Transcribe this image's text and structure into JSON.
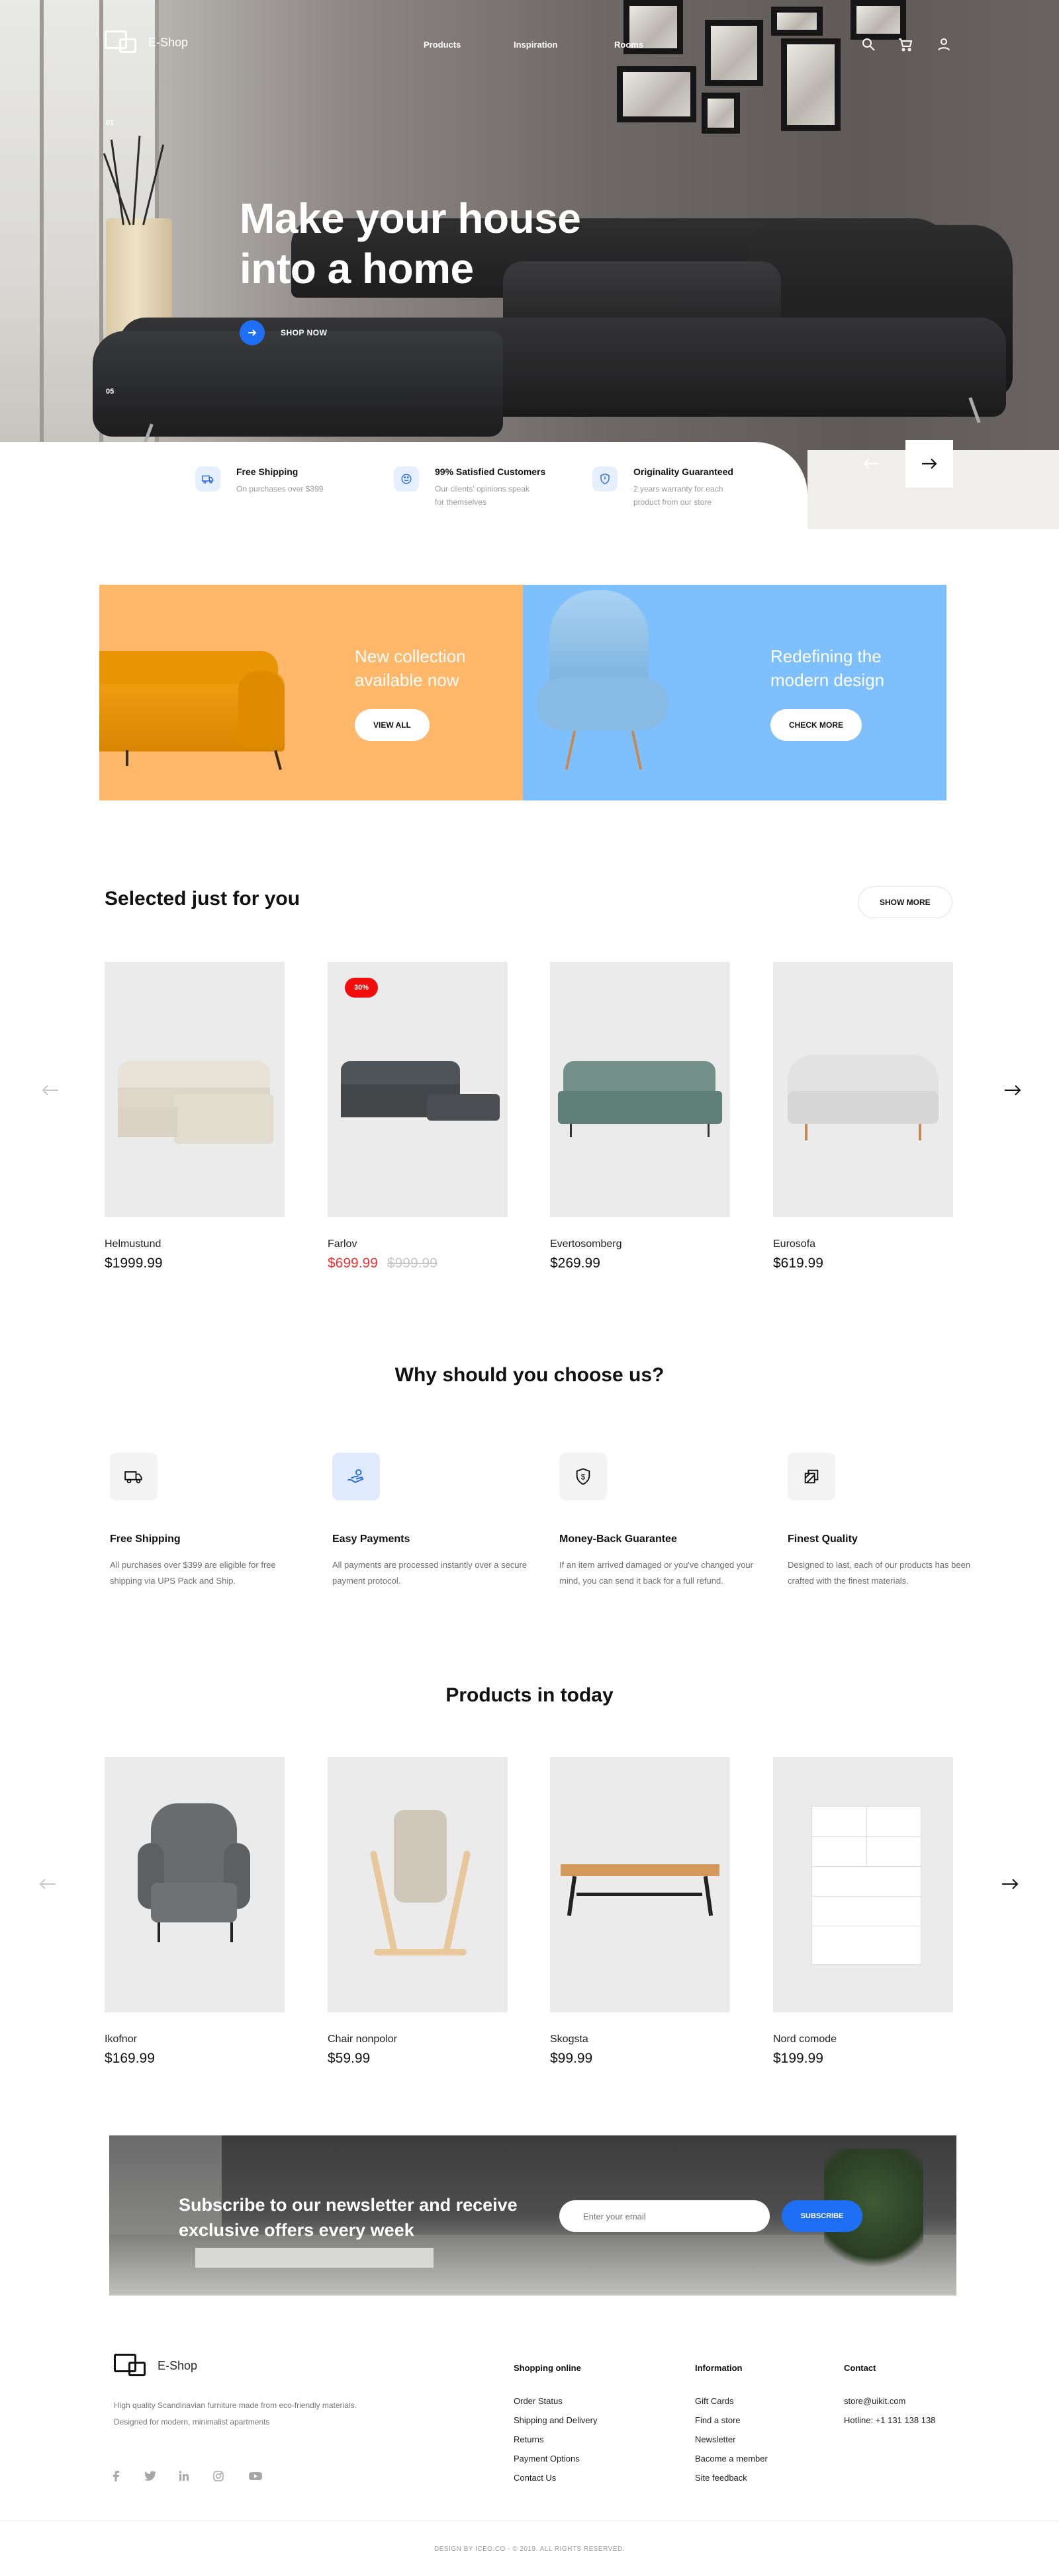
{
  "brand": {
    "name": "E-Shop"
  },
  "nav": {
    "links": [
      "Products",
      "Inspiration",
      "Rooms"
    ]
  },
  "hero": {
    "slide_index": "01",
    "slide_total": "05",
    "title": "Make your house into a home",
    "cta": "SHOP NOW",
    "features": [
      {
        "title": "Free Shipping",
        "text": "On purchases over $399",
        "icon": "truck-icon"
      },
      {
        "title": "99% Satisfied Customers",
        "text": "Our clients' opinions speak for themselves",
        "icon": "smile-icon"
      },
      {
        "title": "Originality Guaranteed",
        "text": "2 years warranty for each product from our store",
        "icon": "shield-icon"
      }
    ]
  },
  "promos": [
    {
      "title": "New collection available now",
      "button": "VIEW ALL",
      "color": "#ffb769"
    },
    {
      "title": "Redefining the modern design",
      "button": "CHECK MORE",
      "color": "#7ec0fd"
    }
  ],
  "selected": {
    "title": "Selected just for you",
    "show_more": "SHOW MORE",
    "products": [
      {
        "name": "Helmustund",
        "price": "$1999.99"
      },
      {
        "name": "Farlov",
        "price": "$699.99",
        "old_price": "$999.99",
        "badge": "30%"
      },
      {
        "name": "Evertosomberg",
        "price": "$269.99"
      },
      {
        "name": "Eurosofa",
        "price": "$619.99"
      }
    ]
  },
  "why": {
    "title": "Why should you choose us?",
    "items": [
      {
        "title": "Free Shipping",
        "text": "All purchases over $399 are eligible for free shipping via UPS Pack and Ship.",
        "icon": "truck-icon"
      },
      {
        "title": "Easy Payments",
        "text": "All payments are processed instantly over a secure payment protocol.",
        "icon": "hand-money-icon"
      },
      {
        "title": "Money-Back Guarantee",
        "text": "If an item arrived damaged or you've changed your mind, you can send it back for a full refund.",
        "icon": "dollar-shield-icon"
      },
      {
        "title": "Finest Quality",
        "text": "Designed to last, each of our products has been crafted with the finest materials.",
        "icon": "quality-icon"
      }
    ]
  },
  "today": {
    "title": "Products in today",
    "products": [
      {
        "name": "Ikofnor",
        "price": "$169.99"
      },
      {
        "name": "Chair nonpolor",
        "price": "$59.99"
      },
      {
        "name": "Skogsta",
        "price": "$99.99"
      },
      {
        "name": "Nord comode",
        "price": "$199.99"
      }
    ]
  },
  "newsletter": {
    "title": "Subscribe to our newsletter and receive exclusive offers every week",
    "placeholder": "Enter your email",
    "button": "SUBSCRIBE"
  },
  "footer": {
    "description": "High quality Scandinavian furniture made from eco-friendly materials. Designed for modern, minimalist apartments",
    "columns": [
      {
        "title": "Shopping online",
        "links": [
          "Order Status",
          "Shipping and Delivery",
          "Returns",
          "Payment Options",
          "Contact Us"
        ]
      },
      {
        "title": "Information",
        "links": [
          "Gift Cards",
          "Find a store",
          "Newsletter",
          "Bacome a member",
          "Site feedback"
        ]
      },
      {
        "title": "Contact",
        "links": [
          "store@uikit.com",
          "Hotline: +1 131 138 138"
        ]
      }
    ],
    "social": [
      "facebook-icon",
      "twitter-icon",
      "linkedin-icon",
      "instagram-icon",
      "youtube-icon"
    ],
    "copyright": "DESIGN BY ICEO.CO - © 2019. ALL RIGHTS RESERVED."
  },
  "colors": {
    "accent": "#1f6ff5",
    "sale": "#f20d0d"
  }
}
